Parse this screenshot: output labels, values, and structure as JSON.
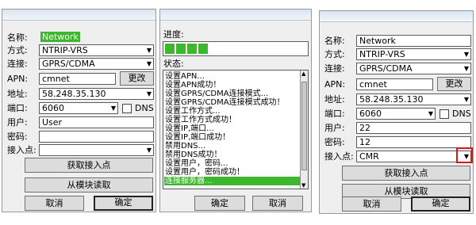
{
  "panel1": {
    "name_label": "名称:",
    "name_value": "Network",
    "mode_label": "方式:",
    "mode_value": "NTRIP-VRS",
    "conn_label": "连接:",
    "conn_value": "GPRS/CDMA",
    "apn_label": "APN:",
    "apn_value": "cmnet",
    "change_button": "更改",
    "addr_label": "地址:",
    "addr_value": "58.248.35.130",
    "port_label": "端口:",
    "port_value": "6060",
    "dns_label": "DNS",
    "user_label": "用户:",
    "user_value": "User",
    "pwd_label": "密码:",
    "pwd_value": "",
    "ap_label": "接入点:",
    "ap_value": "",
    "get_ap_button": "获取接入点",
    "read_button": "从模块读取",
    "cancel_button": "取消",
    "ok_button": "确定"
  },
  "panel2": {
    "progress_label": "进度:",
    "progress_fraction": 0.33,
    "status_label": "状态:",
    "status_lines": [
      "设置APN...",
      "设置APN成功！",
      "设置GPRS/CDMA连接模式...",
      "设置GPRS/CDMA连接模式成功！",
      "设置工作方式...",
      "设置工作方式成功！",
      "设置IP,端口...",
      "设置IP,端口成功！",
      "禁用DNS...",
      "禁用DNS成功！",
      "设置用户，密码...",
      "设置用户，密码成功！",
      "连接服务器..."
    ],
    "ok_button": "确定",
    "cancel_button": "取消"
  },
  "panel3": {
    "name_label": "名称:",
    "name_value": "Network",
    "mode_label": "方式:",
    "mode_value": "NTRIP-VRS",
    "conn_label": "连接:",
    "conn_value": "GPRS/CDMA",
    "apn_label": "APN:",
    "apn_value": "cmnet",
    "change_button": "更改",
    "addr_label": "地址:",
    "addr_value": "58.248.35.130",
    "port_label": "端口:",
    "port_value": "6060",
    "dns_label": "DNS",
    "user_label": "用户:",
    "user_value": "22",
    "pwd_label": "密码:",
    "pwd_value": "12",
    "ap_label": "接入点:",
    "ap_value": "CMR",
    "get_ap_button": "获取接入点",
    "read_button": "从模块读取",
    "cancel_button": "取消",
    "ok_button": "确定"
  },
  "colors": {
    "highlight": "#3db72d",
    "red_box": "#d51a1a"
  }
}
